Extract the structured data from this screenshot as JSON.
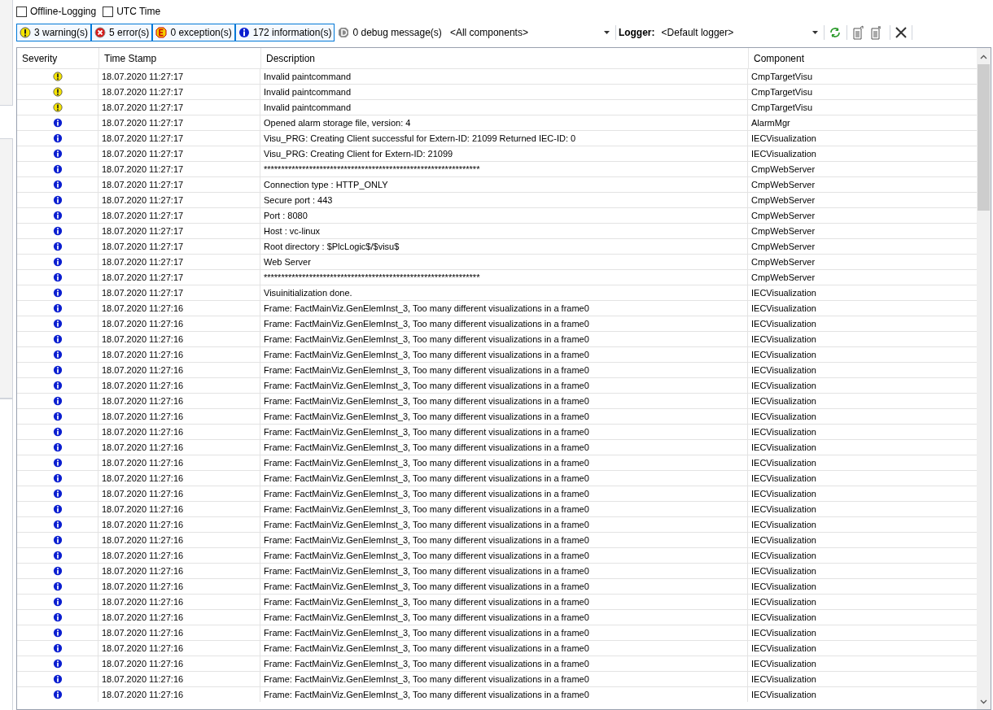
{
  "options": [
    {
      "label": "Offline-Logging",
      "checked": false
    },
    {
      "label": "UTC Time",
      "checked": false
    }
  ],
  "filters": [
    {
      "kind": "warning",
      "label": "3 warning(s)",
      "selected": true
    },
    {
      "kind": "error",
      "label": "5 error(s)",
      "selected": true
    },
    {
      "kind": "exception",
      "label": "0 exception(s)",
      "selected": true
    },
    {
      "kind": "information",
      "label": "172 information(s)",
      "selected": true
    },
    {
      "kind": "debug",
      "label": "0 debug message(s)",
      "selected": false
    }
  ],
  "component_filter": {
    "value": "<All components>"
  },
  "logger": {
    "label": "Logger:",
    "value": "<Default logger>"
  },
  "table": {
    "columns": [
      "Severity",
      "Time Stamp",
      "Description",
      "Component"
    ],
    "rows": [
      {
        "kind": "warning",
        "time": "18.07.2020 11:27:17",
        "description": "Invalid paintcommand",
        "component": "CmpTargetVisu"
      },
      {
        "kind": "warning",
        "time": "18.07.2020 11:27:17",
        "description": "Invalid paintcommand",
        "component": "CmpTargetVisu"
      },
      {
        "kind": "warning",
        "time": "18.07.2020 11:27:17",
        "description": "Invalid paintcommand",
        "component": "CmpTargetVisu"
      },
      {
        "kind": "information",
        "time": "18.07.2020 11:27:17",
        "description": "Opened alarm storage file, version: 4",
        "component": "AlarmMgr"
      },
      {
        "kind": "information",
        "time": "18.07.2020 11:27:17",
        "description": "Visu_PRG: Creating Client successful for Extern-ID: 21099 Returned IEC-ID: 0",
        "component": "IECVisualization"
      },
      {
        "kind": "information",
        "time": "18.07.2020 11:27:17",
        "description": "Visu_PRG: Creating Client for Extern-ID: 21099",
        "component": "IECVisualization"
      },
      {
        "kind": "information",
        "time": "18.07.2020 11:27:17",
        "description": "**************************************************************",
        "component": "CmpWebServer"
      },
      {
        "kind": "information",
        "time": "18.07.2020 11:27:17",
        "description": "Connection type : HTTP_ONLY",
        "component": "CmpWebServer"
      },
      {
        "kind": "information",
        "time": "18.07.2020 11:27:17",
        "description": "Secure port : 443",
        "component": "CmpWebServer"
      },
      {
        "kind": "information",
        "time": "18.07.2020 11:27:17",
        "description": "Port : 8080",
        "component": "CmpWebServer"
      },
      {
        "kind": "information",
        "time": "18.07.2020 11:27:17",
        "description": "Host : vc-linux",
        "component": "CmpWebServer"
      },
      {
        "kind": "information",
        "time": "18.07.2020 11:27:17",
        "description": "Root directory : $PlcLogic$/$visu$",
        "component": "CmpWebServer"
      },
      {
        "kind": "information",
        "time": "18.07.2020 11:27:17",
        "description": "Web Server",
        "component": "CmpWebServer"
      },
      {
        "kind": "information",
        "time": "18.07.2020 11:27:17",
        "description": "**************************************************************",
        "component": "CmpWebServer"
      },
      {
        "kind": "information",
        "time": "18.07.2020 11:27:17",
        "description": "Visuinitialization done.",
        "component": "IECVisualization"
      },
      {
        "kind": "information",
        "time": "18.07.2020 11:27:16",
        "description": "Frame: FactMainViz.GenElemInst_3, Too many different visualizations in a frame0",
        "component": "IECVisualization"
      },
      {
        "kind": "information",
        "time": "18.07.2020 11:27:16",
        "description": "Frame: FactMainViz.GenElemInst_3, Too many different visualizations in a frame0",
        "component": "IECVisualization"
      },
      {
        "kind": "information",
        "time": "18.07.2020 11:27:16",
        "description": "Frame: FactMainViz.GenElemInst_3, Too many different visualizations in a frame0",
        "component": "IECVisualization"
      },
      {
        "kind": "information",
        "time": "18.07.2020 11:27:16",
        "description": "Frame: FactMainViz.GenElemInst_3, Too many different visualizations in a frame0",
        "component": "IECVisualization"
      },
      {
        "kind": "information",
        "time": "18.07.2020 11:27:16",
        "description": "Frame: FactMainViz.GenElemInst_3, Too many different visualizations in a frame0",
        "component": "IECVisualization"
      },
      {
        "kind": "information",
        "time": "18.07.2020 11:27:16",
        "description": "Frame: FactMainViz.GenElemInst_3, Too many different visualizations in a frame0",
        "component": "IECVisualization"
      },
      {
        "kind": "information",
        "time": "18.07.2020 11:27:16",
        "description": "Frame: FactMainViz.GenElemInst_3, Too many different visualizations in a frame0",
        "component": "IECVisualization"
      },
      {
        "kind": "information",
        "time": "18.07.2020 11:27:16",
        "description": "Frame: FactMainViz.GenElemInst_3, Too many different visualizations in a frame0",
        "component": "IECVisualization"
      },
      {
        "kind": "information",
        "time": "18.07.2020 11:27:16",
        "description": "Frame: FactMainViz.GenElemInst_3, Too many different visualizations in a frame0",
        "component": "IECVisualization"
      },
      {
        "kind": "information",
        "time": "18.07.2020 11:27:16",
        "description": "Frame: FactMainViz.GenElemInst_3, Too many different visualizations in a frame0",
        "component": "IECVisualization"
      },
      {
        "kind": "information",
        "time": "18.07.2020 11:27:16",
        "description": "Frame: FactMainViz.GenElemInst_3, Too many different visualizations in a frame0",
        "component": "IECVisualization"
      },
      {
        "kind": "information",
        "time": "18.07.2020 11:27:16",
        "description": "Frame: FactMainViz.GenElemInst_3, Too many different visualizations in a frame0",
        "component": "IECVisualization"
      },
      {
        "kind": "information",
        "time": "18.07.2020 11:27:16",
        "description": "Frame: FactMainViz.GenElemInst_3, Too many different visualizations in a frame0",
        "component": "IECVisualization"
      },
      {
        "kind": "information",
        "time": "18.07.2020 11:27:16",
        "description": "Frame: FactMainViz.GenElemInst_3, Too many different visualizations in a frame0",
        "component": "IECVisualization"
      },
      {
        "kind": "information",
        "time": "18.07.2020 11:27:16",
        "description": "Frame: FactMainViz.GenElemInst_3, Too many different visualizations in a frame0",
        "component": "IECVisualization"
      },
      {
        "kind": "information",
        "time": "18.07.2020 11:27:16",
        "description": "Frame: FactMainViz.GenElemInst_3, Too many different visualizations in a frame0",
        "component": "IECVisualization"
      },
      {
        "kind": "information",
        "time": "18.07.2020 11:27:16",
        "description": "Frame: FactMainViz.GenElemInst_3, Too many different visualizations in a frame0",
        "component": "IECVisualization"
      },
      {
        "kind": "information",
        "time": "18.07.2020 11:27:16",
        "description": "Frame: FactMainViz.GenElemInst_3, Too many different visualizations in a frame0",
        "component": "IECVisualization"
      },
      {
        "kind": "information",
        "time": "18.07.2020 11:27:16",
        "description": "Frame: FactMainViz.GenElemInst_3, Too many different visualizations in a frame0",
        "component": "IECVisualization"
      },
      {
        "kind": "information",
        "time": "18.07.2020 11:27:16",
        "description": "Frame: FactMainViz.GenElemInst_3, Too many different visualizations in a frame0",
        "component": "IECVisualization"
      },
      {
        "kind": "information",
        "time": "18.07.2020 11:27:16",
        "description": "Frame: FactMainViz.GenElemInst_3, Too many different visualizations in a frame0",
        "component": "IECVisualization"
      },
      {
        "kind": "information",
        "time": "18.07.2020 11:27:16",
        "description": "Frame: FactMainViz.GenElemInst_3, Too many different visualizations in a frame0",
        "component": "IECVisualization"
      },
      {
        "kind": "information",
        "time": "18.07.2020 11:27:16",
        "description": "Frame: FactMainViz.GenElemInst_3, Too many different visualizations in a frame0",
        "component": "IECVisualization"
      },
      {
        "kind": "information",
        "time": "18.07.2020 11:27:16",
        "description": "Frame: FactMainViz.GenElemInst_3, Too many different visualizations in a frame0",
        "component": "IECVisualization"
      },
      {
        "kind": "information",
        "time": "18.07.2020 11:27:16",
        "description": "Frame: FactMainViz.GenElemInst_3, Too many different visualizations in a frame0",
        "component": "IECVisualization"
      },
      {
        "kind": "information",
        "time": "18.07.2020 11:27:16",
        "description": "Frame: FactMainViz.GenElemInst_3, Too many different visualizations in a frame0",
        "component": "IECVisualization"
      }
    ]
  }
}
